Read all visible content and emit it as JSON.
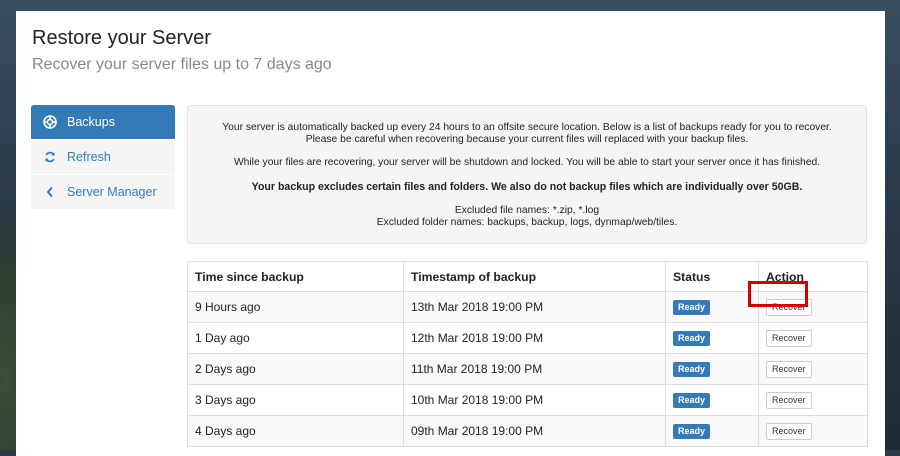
{
  "header": {
    "title": "Restore your Server",
    "subtitle": "Recover your server files up to 7 days ago"
  },
  "sidebar": {
    "items": [
      {
        "label": "Backups",
        "icon": "lifebuoy-icon",
        "active": true
      },
      {
        "label": "Refresh",
        "icon": "refresh-icon",
        "active": false
      },
      {
        "label": "Server Manager",
        "icon": "chevron-left-icon",
        "active": false
      }
    ]
  },
  "info": {
    "line1": "Your server is automatically backed up every 24 hours to an offsite secure location. Below is a list of backups ready for you to recover.",
    "line2": "Please be careful when recovering because your current files will replaced with your backup files.",
    "line3": "While your files are recovering, your server will be shutdown and locked. You will be able to start your server once it has finished.",
    "line4": "Your backup excludes certain files and folders. We also do not backup files which are individually over 50GB.",
    "line5": "Excluded file names: *.zip, *.log",
    "line6": "Excluded folder names: backups, backup, logs, dynmap/web/tiles."
  },
  "table": {
    "headers": [
      "Time since backup",
      "Timestamp of backup",
      "Status",
      "Action"
    ],
    "rows": [
      {
        "since": "9 Hours ago",
        "timestamp": "13th Mar 2018 19:00 PM",
        "status": "Ready",
        "action": "Recover"
      },
      {
        "since": "1 Day ago",
        "timestamp": "12th Mar 2018 19:00 PM",
        "status": "Ready",
        "action": "Recover"
      },
      {
        "since": "2 Days ago",
        "timestamp": "11th Mar 2018 19:00 PM",
        "status": "Ready",
        "action": "Recover"
      },
      {
        "since": "3 Days ago",
        "timestamp": "10th Mar 2018 19:00 PM",
        "status": "Ready",
        "action": "Recover"
      },
      {
        "since": "4 Days ago",
        "timestamp": "09th Mar 2018 19:00 PM",
        "status": "Ready",
        "action": "Recover"
      }
    ]
  },
  "colors": {
    "accent": "#337ab7",
    "highlight": "#d10000"
  }
}
